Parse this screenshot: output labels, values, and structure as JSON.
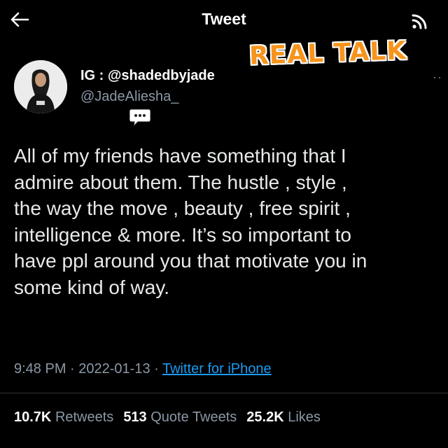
{
  "header": {
    "title": "Tweet"
  },
  "overlay": {
    "badge_text": "REAL TALK"
  },
  "author": {
    "display_name": "IG : @shadedbyjade",
    "handle": "@JadeAliesha_"
  },
  "tweet": {
    "text": "All of my friends have something that I\nadmire about them. The hustle , style ,\nthe way the move , beauty , free spirit ,\nintelligence & more. It’s so important to\nhave ppl around you that motivate you in\nsome kind of way.",
    "time": "9:48 PM",
    "date": "2022-01-13",
    "source": "Twitter for iPhone",
    "separator": " · "
  },
  "stats": {
    "retweets_count": "10.7K",
    "retweets_label": "Retweets",
    "quotes_count": "513",
    "quotes_label": "Quote Tweets",
    "likes_count": "25.2K",
    "likes_label": "Likes"
  },
  "colors": {
    "accent": "#1d9bf0",
    "badge": "#f7941d",
    "background": "#000000"
  },
  "icons": {
    "back": "arrow-left-icon",
    "corner": "wifi-icon",
    "more": "more-icon",
    "speech": "speech-bubble-icon"
  }
}
